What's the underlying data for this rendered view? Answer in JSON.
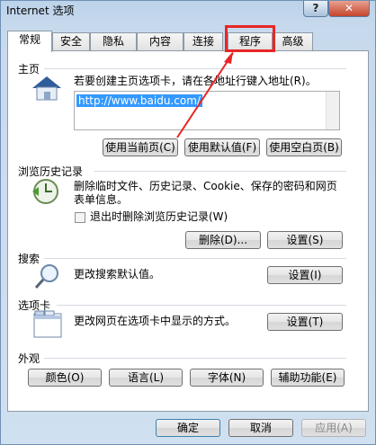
{
  "window": {
    "title": "Internet 选项",
    "help": "?",
    "close": "✕"
  },
  "tabs": [
    {
      "label": "常规",
      "active": true
    },
    {
      "label": "安全"
    },
    {
      "label": "隐私"
    },
    {
      "label": "内容"
    },
    {
      "label": "连接"
    },
    {
      "label": "程序"
    },
    {
      "label": "高级"
    }
  ],
  "home": {
    "title": "主页",
    "desc": "若要创建主页选项卡，请在各地址行键入地址(R)。",
    "url": "http://www.baidu.com/",
    "buttons": [
      "使用当前页(C)",
      "使用默认值(F)",
      "使用空白页(B)"
    ],
    "icon": "house-icon"
  },
  "history": {
    "title": "浏览历史记录",
    "desc": "删除临时文件、历史记录、Cookie、保存的密码和网页表单信息。",
    "checkbox_label": "退出时删除浏览历史记录(W)",
    "delete_btn": "删除(D)...",
    "settings_btn": "设置(S)",
    "icon": "history-clock-icon"
  },
  "search": {
    "title": "搜索",
    "desc": "更改搜索默认值。",
    "settings_btn": "设置(I)",
    "icon": "magnifier-icon"
  },
  "tabsection": {
    "title": "选项卡",
    "desc": "更改网页在选项卡中显示的方式。",
    "settings_btn": "设置(T)",
    "icon": "tabs-window-icon"
  },
  "appearance": {
    "title": "外观",
    "buttons": [
      "颜色(O)",
      "语言(L)",
      "字体(N)",
      "辅助功能(E)"
    ]
  },
  "footer": {
    "ok": "确定",
    "cancel": "取消",
    "apply": "应用(A)"
  },
  "annotation_color": "#e82626"
}
